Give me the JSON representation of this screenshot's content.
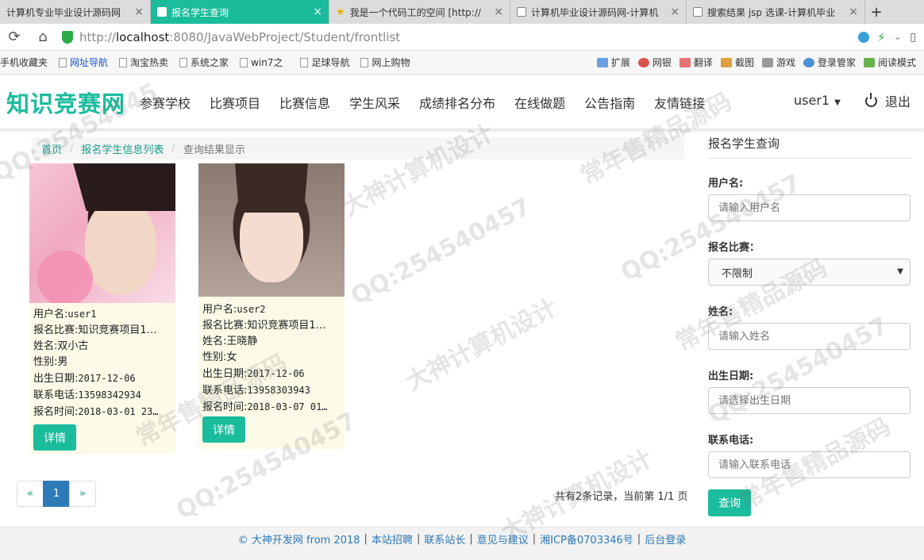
{
  "browser": {
    "tabs": [
      {
        "title": "计算机专业毕业设计源码网",
        "active": false
      },
      {
        "title": "报名学生查询",
        "active": true
      },
      {
        "title": "我是一个代码工的空间 [http://",
        "active": false
      },
      {
        "title": "计算机毕业设计源码网-计算机",
        "active": false
      },
      {
        "title": "搜索结果 jsp 选课-计算机毕业",
        "active": false
      }
    ],
    "url_host": "localhost",
    "url_rest": ":8080/JavaWebProject/Student/frontlist",
    "url_prefix": "http://",
    "bookmarks": [
      "手机收藏夹",
      "网址导航",
      "淘宝热卖",
      "系统之家",
      "win7之",
      "足球导航",
      "网上购物"
    ],
    "bookmarks_right": [
      "扩展",
      "网银",
      "翻译",
      "截图",
      "游戏",
      "登录管家",
      "阅读模式"
    ]
  },
  "header": {
    "logo": "知识竞赛网",
    "nav": [
      "参赛学校",
      "比赛项目",
      "比赛信息",
      "学生风采",
      "成绩排名分布",
      "在线做题",
      "公告指南",
      "友情链接"
    ],
    "user": "user1",
    "logout": "退出"
  },
  "breadcrumb": {
    "home": "首页",
    "list": "报名学生信息列表",
    "current": "查询结果显示"
  },
  "students": [
    {
      "username_label": "用户名:",
      "username": "user1",
      "contest_label": "报名比赛:",
      "contest": "知识竞赛项目1…",
      "name_label": "姓名:",
      "name": "双小古",
      "gender_label": "性别:",
      "gender": "男",
      "birth_label": "出生日期:",
      "birth": "2017-12-06",
      "phone_label": "联系电话:",
      "phone": "13598342934",
      "time_label": "报名时间:",
      "time": "2018-03-01 23…",
      "detail": "详情"
    },
    {
      "username_label": "用户名:",
      "username": "user2",
      "contest_label": "报名比赛:",
      "contest": "知识竞赛项目1…",
      "name_label": "姓名:",
      "name": "王晓静",
      "gender_label": "性别:",
      "gender": "女",
      "birth_label": "出生日期:",
      "birth": "2017-12-06",
      "phone_label": "联系电话:",
      "phone": "13958303943",
      "time_label": "报名时间:",
      "time": "2018-03-07 01…",
      "detail": "详情"
    }
  ],
  "pagination": {
    "prev": "«",
    "current": "1",
    "next": "»",
    "summary": "共有2条记录，当前第 1/1 页"
  },
  "sidebar": {
    "title": "报名学生查询",
    "username_label": "用户名:",
    "username_placeholder": "请输入用户名",
    "contest_label": "报名比赛：",
    "contest_value": "不限制",
    "name_label": "姓名:",
    "name_placeholder": "请输入姓名",
    "birth_label": "出生日期:",
    "birth_placeholder": "请选择出生日期",
    "phone_label": "联系电话:",
    "phone_placeholder": "请输入联系电话",
    "query_button": "查询"
  },
  "footer": {
    "items": [
      "© 大神开发网 from 2018",
      "本站招聘",
      "联系站长",
      "意见与建议",
      "湘ICP备0703346号",
      "后台登录"
    ]
  },
  "watermarks": [
    "QQ:25454045",
    "大神计算机设计",
    "常年售精品源码",
    "QQ:254540457",
    "大神计算机设计",
    "常年售精品源码",
    "QQ:254540457",
    "QQ:254540457",
    "常年售精品源码",
    "大神计算机设计",
    "QQ:254540457",
    "常年售精品源码"
  ]
}
